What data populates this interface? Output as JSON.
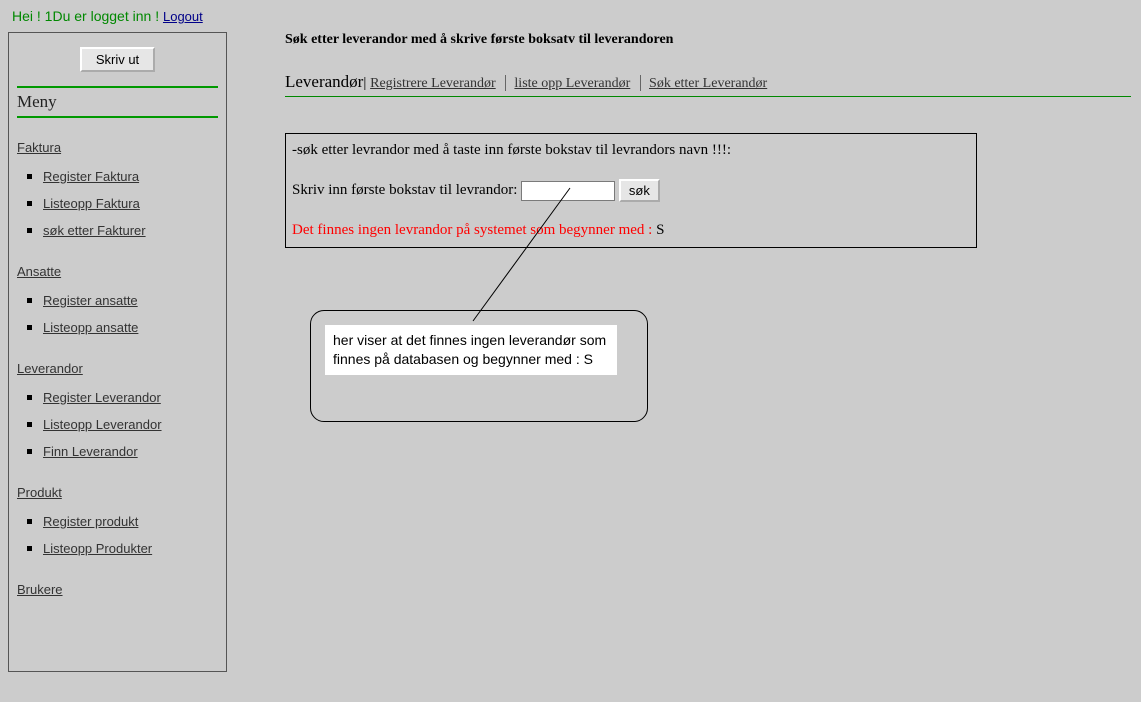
{
  "header": {
    "greeting": "Hei ! 1Du er logget inn ! ",
    "logout": "Logout"
  },
  "sidebar": {
    "print_label": "Skriv ut",
    "menu_title": "Meny",
    "sections": [
      {
        "head": "Faktura",
        "items": [
          "Register Faktura",
          "Listeopp Faktura",
          "søk etter Fakturer"
        ]
      },
      {
        "head": "Ansatte",
        "items": [
          "Register ansatte",
          "Listeopp ansatte"
        ]
      },
      {
        "head": "Leverandor",
        "items": [
          "Register Leverandor",
          "Listeopp Leverandor",
          "Finn Leverandor"
        ]
      },
      {
        "head": "Produkt",
        "items": [
          "Register produkt",
          "Listeopp Produkter"
        ]
      },
      {
        "head": "Brukere",
        "items": []
      }
    ]
  },
  "content": {
    "page_title": "Søk etter leverandor med å skrive første boksatv til leverandoren",
    "subnav": {
      "lead": "Leverandør",
      "links": [
        "Registrere Leverandør",
        "liste opp Leverandør",
        "Søk etter Leverandør"
      ]
    },
    "searchbox": {
      "instruction": "-søk etter levrandor med å taste inn første bokstav til levrandors navn !!!:",
      "label": "Skriv inn første bokstav til levrandor: ",
      "input_value": "",
      "button": "søk",
      "error_prefix": "Det finnes ingen levrandor på systemet som begynner med : ",
      "error_letter": "S"
    }
  },
  "callout": {
    "text": "her viser at det finnes ingen leverandør som finnes på databasen og begynner med  : S"
  }
}
